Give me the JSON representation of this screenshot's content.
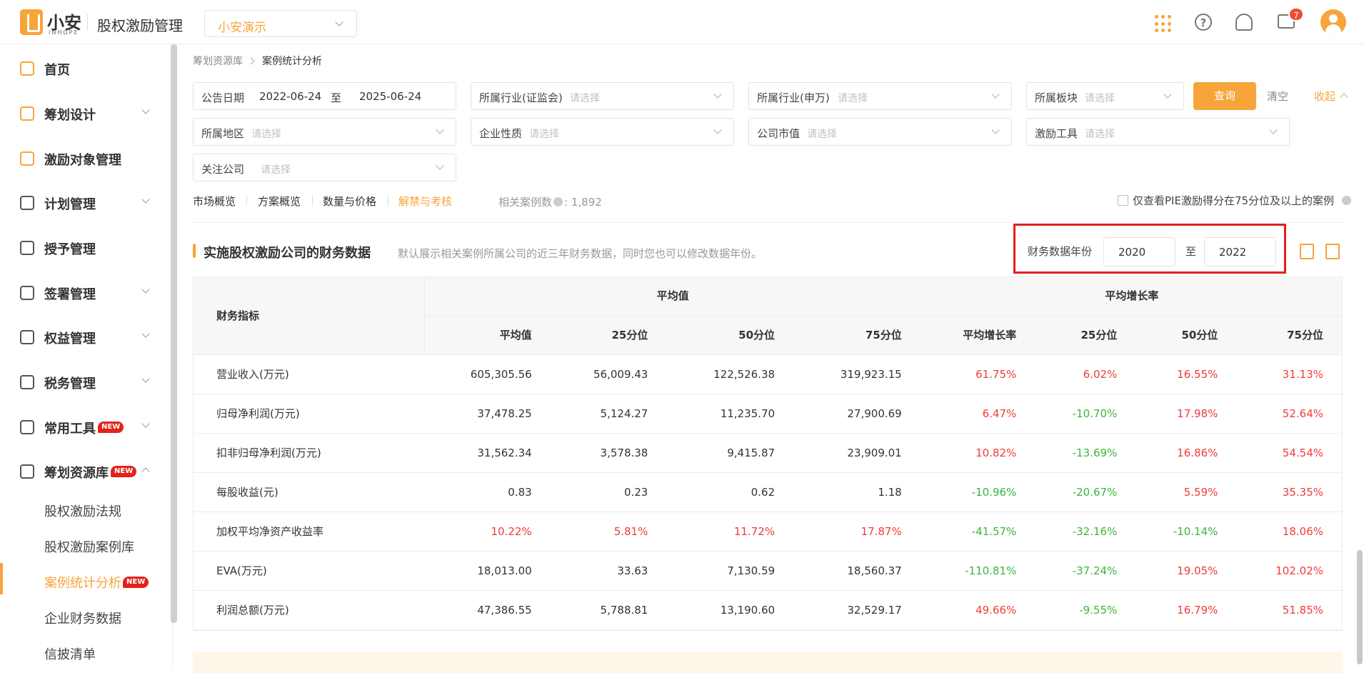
{
  "header": {
    "logo_text": "小安",
    "logo_sub": "INHOPE",
    "app_title": "股权激励管理",
    "company": "小安演示",
    "message_count": "7"
  },
  "sidebar": {
    "items": [
      {
        "label": "首页",
        "icon": "home-icon"
      },
      {
        "label": "筹划设计",
        "icon": "edit-icon"
      },
      {
        "label": "激励对象管理",
        "icon": "users-icon"
      },
      {
        "label": "计划管理",
        "icon": "plan-icon"
      },
      {
        "label": "授予管理",
        "icon": "grant-icon"
      },
      {
        "label": "签署管理",
        "icon": "sign-icon"
      },
      {
        "label": "权益管理",
        "icon": "equity-icon"
      },
      {
        "label": "税务管理",
        "icon": "tax-icon"
      },
      {
        "label": "常用工具",
        "icon": "toolbox-icon",
        "badge": "NEW"
      },
      {
        "label": "筹划资源库",
        "icon": "layers-icon",
        "badge": "NEW"
      }
    ],
    "sub_items": [
      {
        "label": "股权激励法规"
      },
      {
        "label": "股权激励案例库"
      },
      {
        "label": "案例统计分析",
        "badge": "NEW"
      },
      {
        "label": "企业财务数据"
      },
      {
        "label": "信披清单"
      }
    ]
  },
  "breadcrumb": {
    "parent": "筹划资源库",
    "current": "案例统计分析"
  },
  "filters": {
    "date_label": "公告日期",
    "date_from": "2022-06-24",
    "date_to_sep": "至",
    "date_to": "2025-06-24",
    "csrc_industry": {
      "label": "所属行业(证监会)",
      "placeholder": "请选择"
    },
    "sw_industry": {
      "label": "所属行业(申万)",
      "placeholder": "请选择"
    },
    "board": {
      "label": "所属板块",
      "placeholder": "请选择"
    },
    "region": {
      "label": "所属地区",
      "placeholder": "请选择"
    },
    "nature": {
      "label": "企业性质",
      "placeholder": "请选择"
    },
    "market_cap": {
      "label": "公司市值",
      "placeholder": "请选择"
    },
    "tool": {
      "label": "激励工具",
      "placeholder": "请选择"
    },
    "follow": {
      "label": "关注公司",
      "placeholder": "请选择"
    },
    "query_label": "查询",
    "clear_label": "清空",
    "collapse_label": "收起"
  },
  "tabs": [
    "市场概览",
    "方案概览",
    "数量与价格",
    "解禁与考核"
  ],
  "active_tab": "解禁与考核",
  "case_count": {
    "label": "相关案例数",
    "value": "1,892"
  },
  "pie_filter_label": "仅查看PIE激励得分在75分位及以上的案例",
  "section": {
    "title": "实施股权激励公司的财务数据",
    "desc": "默认展示相关案例所属公司的近三年财务数据，同时您也可以修改数据年份。",
    "year_label": "财务数据年份",
    "year_from": "2020",
    "year_to_sep": "至",
    "year_to": "2022"
  },
  "table": {
    "metric_header": "财务指标",
    "group_avg": "平均值",
    "group_growth": "平均增长率",
    "sub_headers": [
      "平均值",
      "25分位",
      "50分位",
      "75分位",
      "平均增长率",
      "25分位",
      "50分位",
      "75分位"
    ],
    "rows": [
      {
        "metric": "营业收入(万元)",
        "values": [
          "605,305.56",
          "56,009.43",
          "122,526.38",
          "319,923.15",
          "61.75%",
          "6.02%",
          "16.55%",
          "31.13%"
        ]
      },
      {
        "metric": "归母净利润(万元)",
        "values": [
          "37,478.25",
          "5,124.27",
          "11,235.70",
          "27,900.69",
          "6.47%",
          "-10.70%",
          "17.98%",
          "52.64%"
        ]
      },
      {
        "metric": "扣非归母净利润(万元)",
        "values": [
          "31,562.34",
          "3,578.38",
          "9,415.87",
          "23,909.01",
          "10.82%",
          "-13.69%",
          "16.86%",
          "54.54%"
        ]
      },
      {
        "metric": "每股收益(元)",
        "values": [
          "0.83",
          "0.23",
          "0.62",
          "1.18",
          "-10.96%",
          "-20.67%",
          "5.59%",
          "35.35%"
        ]
      },
      {
        "metric": "加权平均净资产收益率",
        "values": [
          "10.22%",
          "5.81%",
          "11.72%",
          "17.87%",
          "-41.57%",
          "-32.16%",
          "-10.14%",
          "18.06%"
        ]
      },
      {
        "metric": "EVA(万元)",
        "values": [
          "18,013.00",
          "33.63",
          "7,130.59",
          "18,560.37",
          "-110.81%",
          "-37.24%",
          "19.05%",
          "102.02%"
        ]
      },
      {
        "metric": "利润总额(万元)",
        "values": [
          "47,386.55",
          "5,788.81",
          "13,190.60",
          "32,529.17",
          "49.66%",
          "-9.55%",
          "16.79%",
          "51.85%"
        ]
      }
    ]
  },
  "colors": {
    "accent": "#f7a43a",
    "positive": "#ef3b3b",
    "negative": "#3bb53b",
    "highlight_box": "#e02020"
  }
}
